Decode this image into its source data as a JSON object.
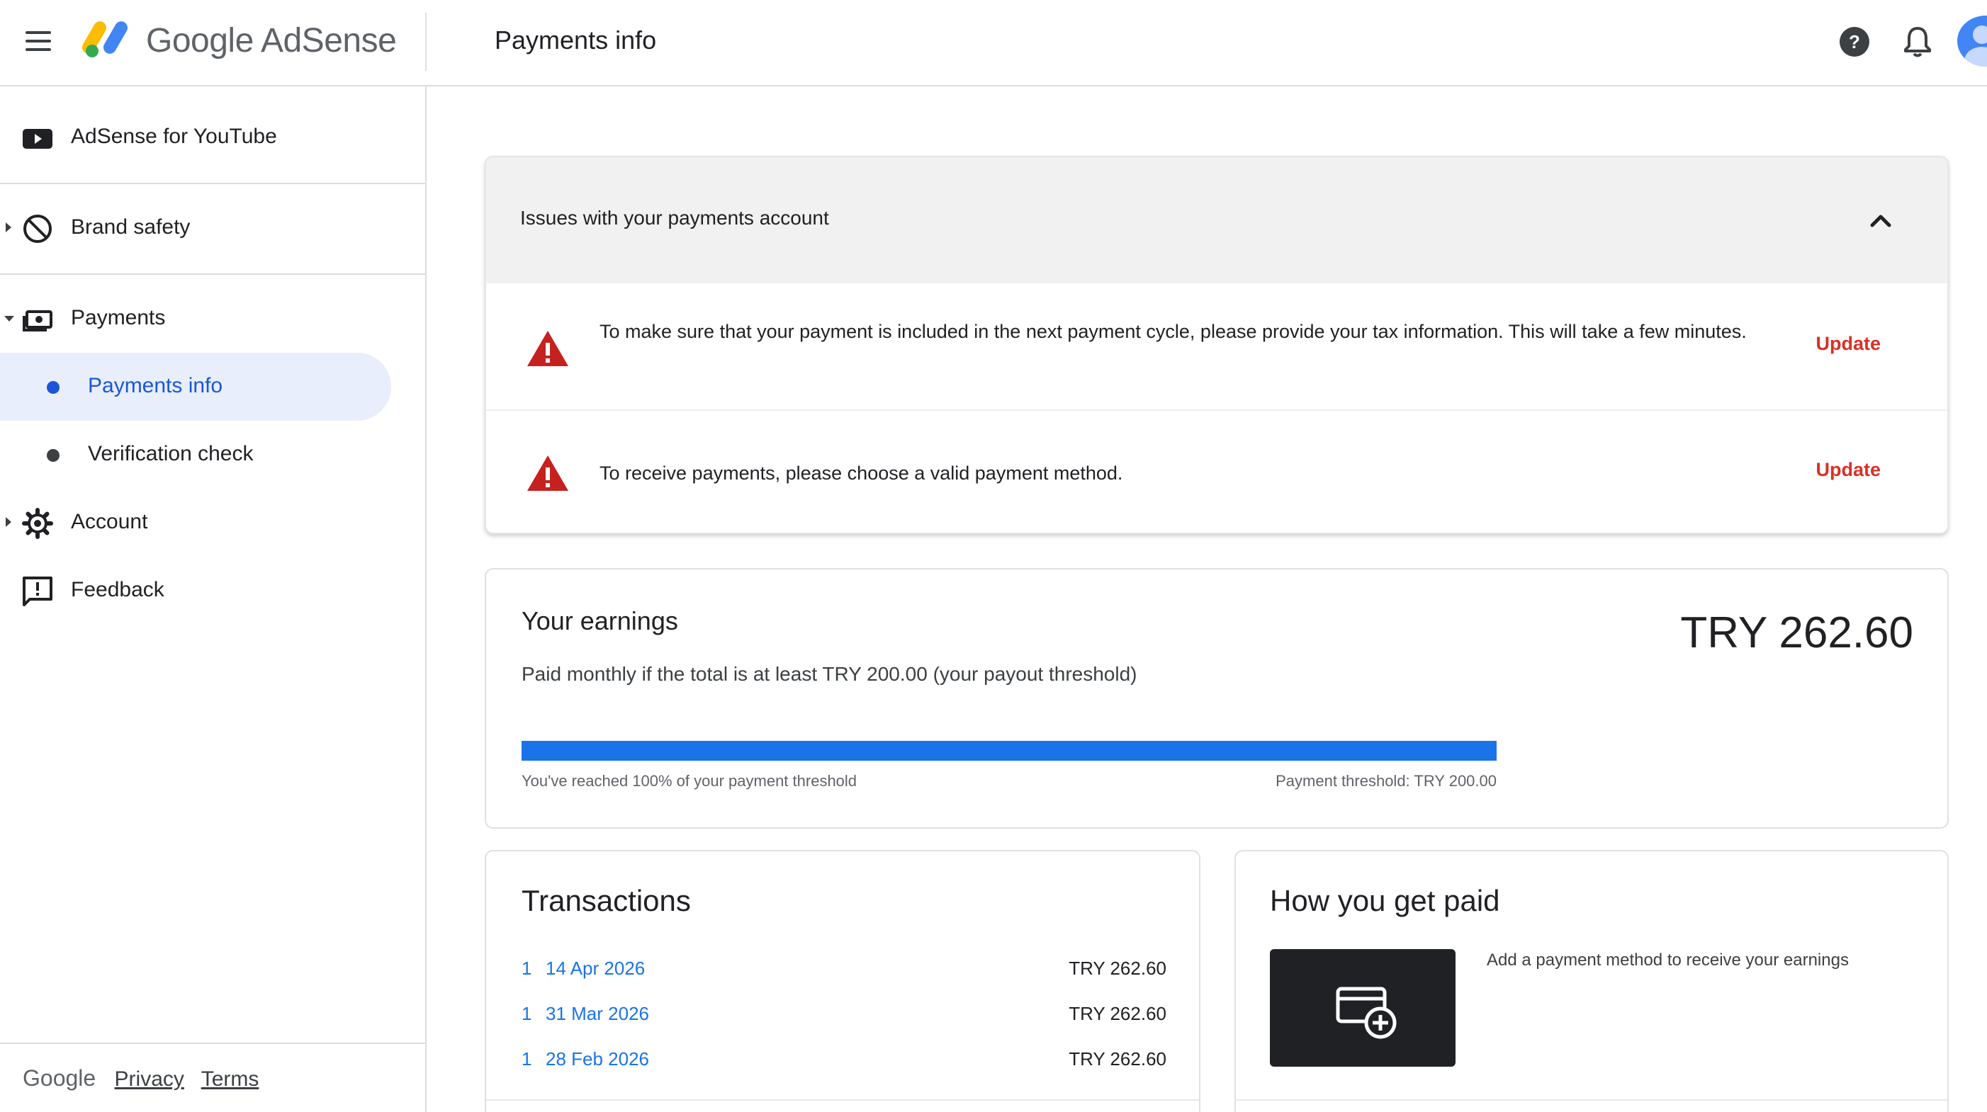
{
  "header": {
    "brand": "Google AdSense",
    "page_title": "Payments info"
  },
  "sidebar": {
    "items": [
      {
        "label": "AdSense for YouTube",
        "icon": "youtube-icon"
      },
      {
        "label": "Brand safety",
        "icon": "block-icon"
      },
      {
        "label": "Payments",
        "icon": "payments-icon"
      },
      {
        "label": "Account",
        "icon": "gear-icon"
      },
      {
        "label": "Feedback",
        "icon": "feedback-icon"
      }
    ],
    "sub_items": [
      {
        "label": "Payments info",
        "active": true
      },
      {
        "label": "Verification check",
        "active": false
      }
    ],
    "footer": {
      "brand": "Google",
      "privacy": "Privacy",
      "terms": "Terms"
    }
  },
  "issues": {
    "title": "Issues with your payments account",
    "rows": [
      {
        "text": "To make sure that your payment is included in the next payment cycle, please provide your tax information. This will take a few minutes.",
        "action": "Update"
      },
      {
        "text": "To receive payments, please choose a valid payment method.",
        "action": "Update"
      }
    ]
  },
  "earnings": {
    "title": "Your earnings",
    "amount": "TRY 262.60",
    "description": "Paid monthly if the total is at least TRY 200.00 (your payout threshold)",
    "progress_percent": 100,
    "progress_left": "You've reached 100% of your payment threshold",
    "progress_right": "Payment threshold: TRY 200.00"
  },
  "transactions": {
    "title": "Transactions",
    "rows": [
      {
        "count": "1",
        "date": "14 Apr 2026",
        "amount": "TRY 262.60"
      },
      {
        "count": "1",
        "date": "31 Mar 2026",
        "amount": "TRY 262.60"
      },
      {
        "count": "1",
        "date": "28 Feb 2026",
        "amount": "TRY 262.60"
      }
    ]
  },
  "get_paid": {
    "title": "How you get paid",
    "text": "Add a payment method to receive your earnings"
  },
  "colors": {
    "accent": "#1a73e8",
    "active_nav_bg": "#e8eefb",
    "warning": "#d93025",
    "issues_header_bg": "#f1f1f1"
  }
}
